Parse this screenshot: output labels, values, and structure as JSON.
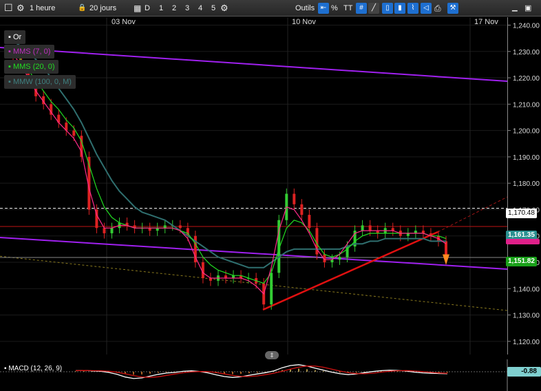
{
  "toolbar": {
    "timeframe": "1 heure",
    "range": "20 jours",
    "range_buttons": [
      "D",
      "1",
      "2",
      "3",
      "4",
      "5"
    ],
    "outils_label": "Outils",
    "tool_percent": "%",
    "tool_text": "TT"
  },
  "legend": {
    "instrument": "Or",
    "sma7": "MMS (7, 0)",
    "sma20": "MMS (20, 0)",
    "smw100": "MMW (100, 0, M)"
  },
  "macd_label": "MACD (12, 26, 9)",
  "macd_value": "-0.88",
  "price_tags": {
    "dashed_level": "1,170.48",
    "sell": "1,161.35",
    "last": "1,151.82"
  },
  "colors": {
    "sma7": "#ff2a8a",
    "sma20": "#22dd22",
    "smw100": "#2f6f6f",
    "channel": "#a020f0",
    "trendline": "#e01010",
    "up_candle": "#33cc33",
    "down_candle": "#dd2222"
  },
  "chart_data": {
    "type": "line",
    "x_labels": [
      "03 Nov",
      "10 Nov",
      "17 Nov"
    ],
    "y_ticks": [
      "1,240.00",
      "1,230.00",
      "1,220.00",
      "1,210.00",
      "1,200.00",
      "1,190.00",
      "1,180.00",
      "1,170.00",
      "1,160.00",
      "1,150.00",
      "1,140.00",
      "1,130.00",
      "1,120.00"
    ],
    "ylim": [
      1115,
      1243
    ],
    "price_series": [
      1230,
      1228,
      1224,
      1218,
      1213,
      1210,
      1206,
      1203,
      1200,
      1198,
      1190,
      1170,
      1163,
      1161,
      1163,
      1165,
      1164,
      1163,
      1163,
      1162,
      1163,
      1164,
      1164,
      1163,
      1160,
      1150,
      1144,
      1143,
      1145,
      1144,
      1145,
      1144,
      1144,
      1142,
      1134,
      1146,
      1166,
      1176,
      1172,
      1168,
      1163,
      1153,
      1150,
      1151,
      1152,
      1156,
      1162,
      1164,
      1162,
      1161,
      1163,
      1162,
      1160,
      1161,
      1162,
      1161,
      1160,
      1158,
      1153
    ],
    "sma7": [
      1230,
      1229,
      1225,
      1220,
      1215,
      1211,
      1207,
      1203,
      1200,
      1197,
      1192,
      1178,
      1168,
      1163,
      1163,
      1164,
      1164,
      1163,
      1163,
      1163,
      1163,
      1163,
      1163,
      1162,
      1159,
      1152,
      1146,
      1144,
      1144,
      1144,
      1144,
      1144,
      1143,
      1141,
      1138,
      1148,
      1162,
      1171,
      1170,
      1166,
      1161,
      1155,
      1151,
      1151,
      1153,
      1157,
      1161,
      1162,
      1162,
      1162,
      1162,
      1162,
      1161,
      1161,
      1161,
      1161,
      1160,
      1159,
      1157
    ],
    "sma20": [
      1232,
      1230,
      1227,
      1223,
      1219,
      1215,
      1211,
      1208,
      1204,
      1201,
      1196,
      1187,
      1178,
      1171,
      1167,
      1165,
      1164,
      1163,
      1163,
      1163,
      1163,
      1163,
      1163,
      1162,
      1161,
      1157,
      1152,
      1149,
      1147,
      1146,
      1145,
      1145,
      1144,
      1143,
      1142,
      1146,
      1155,
      1163,
      1166,
      1165,
      1162,
      1157,
      1153,
      1152,
      1153,
      1155,
      1158,
      1160,
      1161,
      1161,
      1161,
      1161,
      1161,
      1161,
      1161,
      1161,
      1160,
      1160,
      1159
    ],
    "smw100": [
      1235,
      1234,
      1232,
      1230,
      1227,
      1224,
      1220,
      1216,
      1212,
      1208,
      1203,
      1197,
      1191,
      1186,
      1181,
      1177,
      1174,
      1171,
      1169,
      1168,
      1167,
      1166,
      1164,
      1162,
      1160,
      1158,
      1156,
      1154,
      1152,
      1151,
      1150,
      1149,
      1148,
      1148,
      1148,
      1150,
      1152,
      1154,
      1155,
      1155,
      1155,
      1155,
      1155,
      1155,
      1155,
      1156,
      1157,
      1157,
      1158,
      1158,
      1159,
      1159,
      1159,
      1159,
      1159,
      1159,
      1158,
      1158,
      1158
    ],
    "macd": [
      0.5,
      0.6,
      0.4,
      0.2,
      -0.3,
      -1.2,
      -2.4,
      -3.1,
      -2.8,
      -2.0,
      -1.2,
      -0.6,
      -0.3,
      0.2,
      0.4,
      0.1,
      -0.5,
      -1.4,
      -2.2,
      -2.6,
      -2.3,
      -1.6,
      -1.0,
      -0.4,
      0.4,
      1.8,
      2.8,
      3.2,
      2.6,
      1.6,
      0.7,
      -0.2,
      -0.9,
      -1.3,
      -1.0,
      -0.4,
      0.1,
      0.5,
      0.7,
      0.6,
      0.3,
      -0.2,
      -0.5,
      -0.7,
      -0.8,
      -0.9
    ]
  }
}
